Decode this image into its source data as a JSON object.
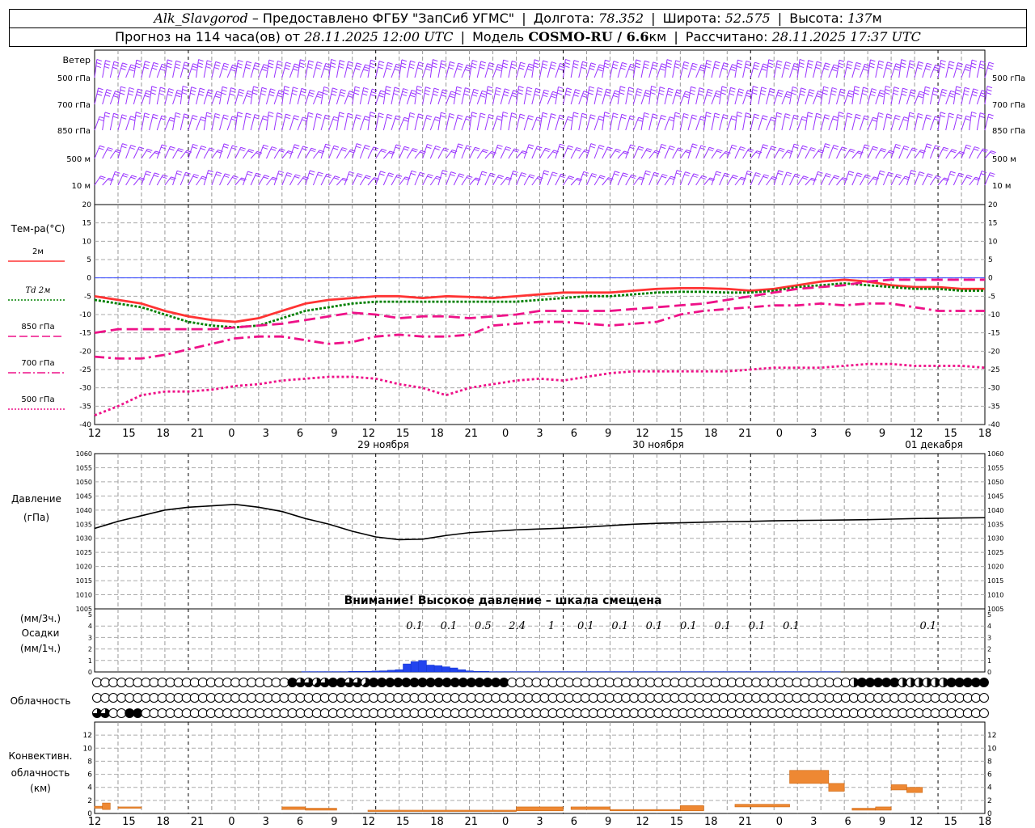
{
  "header": {
    "station": "Alk_Slavgorod",
    "provider": "– Предоставлено ФГБУ \"ЗапСиб УГМС\"",
    "lon_label": "Долгота:",
    "lon": "78.352",
    "lat_label": "Широта:",
    "lat": "52.575",
    "alt_label": "Высота:",
    "alt": "137",
    "alt_unit": "м",
    "forecast_label": "Прогноз на 114 часа(ов) от",
    "forecast_start": "28.11.2025 12:00 UTC",
    "model_label": "Модель",
    "model": "COSMO-RU / 6.6",
    "model_unit": "км",
    "computed_label": "Рассчитано:",
    "computed": "28.11.2025 17:37 UTC"
  },
  "x_axis": {
    "hour_labels": [
      "12",
      "15",
      "18",
      "21",
      "0",
      "3",
      "6",
      "9",
      "12",
      "15",
      "18",
      "21",
      "0",
      "3",
      "6",
      "9",
      "12",
      "15",
      "18",
      "21",
      "0",
      "3",
      "6",
      "9",
      "12",
      "15",
      "18"
    ],
    "day_labels": [
      "29 ноября",
      "30 ноября",
      "01 декабря"
    ]
  },
  "wind_panel": {
    "title": "Ветер",
    "levels": [
      "500 гПа",
      "700 гПа",
      "850 гПа",
      "500 м",
      "10 м"
    ],
    "color": "#9933ff"
  },
  "temp_panel": {
    "title": "Тем-ра(°С)",
    "legend": [
      {
        "label": "2м",
        "color": "#ff3333",
        "style": "solid"
      },
      {
        "label": "Td  2м",
        "color": "#008000",
        "style": "dotted"
      },
      {
        "label": "850 гПа",
        "color": "#ee1188",
        "style": "longdash"
      },
      {
        "label": "700 гПа",
        "color": "#ee1188",
        "style": "dashdot"
      },
      {
        "label": "500 гПа",
        "color": "#ee1188",
        "style": "dotted"
      }
    ],
    "y_ticks": [
      "20",
      "15",
      "10",
      "5",
      "0",
      "-5",
      "-10",
      "-15",
      "-20",
      "-25",
      "-30",
      "-35",
      "-40"
    ]
  },
  "pressure_panel": {
    "title": "Давление",
    "unit": "(гПа)",
    "y_ticks": [
      "1060",
      "1055",
      "1050",
      "1045",
      "1040",
      "1035",
      "1030",
      "1025",
      "1020",
      "1015",
      "1010",
      "1005"
    ],
    "warning": "Внимание! Высокое давление – шкала смещена"
  },
  "precip_panel": {
    "title_lines": [
      "(мм/3ч.)",
      "Осадки",
      "(мм/1ч.)"
    ],
    "y_ticks": [
      "5",
      "4",
      "3",
      "2",
      "1",
      "0"
    ],
    "totals": [
      {
        "i": 9,
        "v": "0.1"
      },
      {
        "i": 10,
        "v": "0.1"
      },
      {
        "i": 11,
        "v": "0.5"
      },
      {
        "i": 12,
        "v": "2.4"
      },
      {
        "i": 13,
        "v": "1"
      },
      {
        "i": 14,
        "v": "0.1"
      },
      {
        "i": 15,
        "v": "0.1"
      },
      {
        "i": 16,
        "v": "0.1"
      },
      {
        "i": 17,
        "v": "0.1"
      },
      {
        "i": 18,
        "v": "0.1"
      },
      {
        "i": 19,
        "v": "0.1"
      },
      {
        "i": 20,
        "v": "0.1"
      },
      {
        "i": 24,
        "v": "0.1"
      }
    ]
  },
  "cloud_panel": {
    "title": "Облачность"
  },
  "conv_panel": {
    "title_lines": [
      "Конвективн.",
      "облачность",
      "(км)"
    ],
    "y_ticks": [
      "12",
      "10",
      "8",
      "6",
      "4",
      "2",
      "0"
    ]
  },
  "chart_data": [
    {
      "type": "line",
      "title": "Тем-ра(°С)",
      "ylim": [
        -40,
        20
      ],
      "x_hours": [
        0,
        3,
        6,
        9,
        12,
        15,
        18,
        21,
        24,
        27,
        30,
        33,
        36,
        39,
        42,
        45,
        48,
        51,
        54,
        57,
        60,
        63,
        66,
        69,
        72,
        75,
        78,
        81,
        84,
        87,
        90,
        93,
        96,
        99,
        102,
        105,
        108,
        111,
        114
      ],
      "series": [
        {
          "name": "2м",
          "values": [
            -5,
            -6,
            -7,
            -9,
            -10.5,
            -11.5,
            -12,
            -11,
            -9,
            -7,
            -6,
            -5.5,
            -5,
            -5,
            -5.5,
            -5,
            -5.2,
            -5.5,
            -5,
            -4.5,
            -4,
            -4,
            -4,
            -3.5,
            -3,
            -2.8,
            -2.8,
            -3,
            -3.5,
            -3,
            -2,
            -1,
            -0.5,
            -1,
            -2,
            -2.5,
            -2.5,
            -3,
            -3
          ]
        },
        {
          "name": "Td  2м",
          "values": [
            -6,
            -7,
            -8,
            -10,
            -12,
            -13,
            -13.5,
            -13,
            -11,
            -9,
            -8,
            -7,
            -6.5,
            -6.5,
            -6.5,
            -6.5,
            -6.5,
            -6.5,
            -6.5,
            -6,
            -5.5,
            -5,
            -5,
            -4.5,
            -4,
            -3.8,
            -3.8,
            -4,
            -4,
            -3.5,
            -2.5,
            -2,
            -1.5,
            -2,
            -2.5,
            -3,
            -3,
            -3.5,
            -3.5
          ]
        },
        {
          "name": "850 гПа",
          "values": [
            -15,
            -14,
            -14,
            -14,
            -14,
            -14,
            -13.5,
            -13,
            -12.5,
            -11.5,
            -10.5,
            -9.5,
            -10,
            -11,
            -10.5,
            -10.5,
            -11,
            -10.5,
            -10,
            -9,
            -9,
            -9,
            -9,
            -8.5,
            -8,
            -7.5,
            -7,
            -6,
            -5,
            -4,
            -3,
            -2.5,
            -2,
            -1,
            -0.5,
            -0.5,
            -0.5,
            -0.5,
            -0.5
          ]
        },
        {
          "name": "700 гПа",
          "values": [
            -21.5,
            -22,
            -22,
            -21,
            -19.5,
            -18,
            -16.5,
            -16,
            -16,
            -17,
            -18,
            -17.5,
            -16,
            -15.5,
            -16,
            -16,
            -15.5,
            -13,
            -12.5,
            -12,
            -12,
            -12.5,
            -13,
            -12.5,
            -12,
            -10,
            -9,
            -8.5,
            -8,
            -7.5,
            -7.5,
            -7,
            -7.5,
            -7,
            -7,
            -8,
            -9,
            -9,
            -9
          ]
        },
        {
          "name": "500 гПа",
          "values": [
            -37.5,
            -35,
            -32,
            -31,
            -31,
            -30.5,
            -29.5,
            -29,
            -28,
            -27.5,
            -27,
            -27,
            -27.5,
            -29,
            -30,
            -32,
            -30,
            -29,
            -28,
            -27.5,
            -28,
            -27,
            -26,
            -25.5,
            -25.5,
            -25.5,
            -25.5,
            -25.5,
            -25,
            -24.5,
            -24.5,
            -24.5,
            -24,
            -23.5,
            -23.5,
            -24,
            -24,
            -24,
            -24.5
          ]
        }
      ]
    },
    {
      "type": "line",
      "title": "Давление",
      "ylabel": "(гПа)",
      "ylim": [
        1005,
        1060
      ],
      "x_hours": [
        0,
        3,
        6,
        9,
        12,
        15,
        18,
        21,
        24,
        27,
        30,
        33,
        36,
        39,
        42,
        45,
        48,
        51,
        54,
        57,
        60,
        63,
        66,
        69,
        72,
        75,
        78,
        81,
        84,
        87,
        90,
        93,
        96,
        99,
        102,
        105,
        108,
        111,
        114
      ],
      "series": [
        {
          "name": "",
          "values": [
            1033.5,
            1036,
            1038,
            1040,
            1041,
            1041.5,
            1042,
            1041,
            1039.5,
            1037,
            1035,
            1032.5,
            1030.5,
            1029.5,
            1029.7,
            1031,
            1032,
            1032.5,
            1033,
            1033.3,
            1033.6,
            1034,
            1034.5,
            1035,
            1035.3,
            1035.5,
            1035.7,
            1035.9,
            1036,
            1036.2,
            1036.3,
            1036.4,
            1036.5,
            1036.6,
            1036.8,
            1037,
            1037.1,
            1037.2,
            1037.3
          ]
        }
      ]
    },
    {
      "type": "bar",
      "title": "Осадки",
      "ylabel": "(мм/1ч.)",
      "ylim": [
        0,
        5
      ],
      "x_hours": [
        27,
        28,
        29,
        30,
        31,
        32,
        33,
        34,
        35,
        36,
        37,
        38,
        39,
        40,
        41,
        42,
        43,
        44,
        45,
        46,
        47,
        48,
        49,
        50,
        51,
        52,
        53,
        54,
        55,
        56,
        57,
        58,
        59,
        60,
        61,
        62,
        63,
        64,
        65,
        66,
        67,
        68,
        69,
        70,
        71,
        72,
        73,
        74,
        75,
        76,
        77,
        78,
        79,
        80,
        81,
        82,
        83,
        84,
        85,
        86,
        87,
        88,
        89,
        90,
        91,
        92,
        93,
        94,
        95
      ],
      "values": [
        0.03,
        0.03,
        0.03,
        0.03,
        0.03,
        0.03,
        0.05,
        0.05,
        0.05,
        0.08,
        0.1,
        0.15,
        0.2,
        0.7,
        0.9,
        1.0,
        0.6,
        0.55,
        0.45,
        0.35,
        0.2,
        0.1,
        0.05,
        0.05,
        0.03,
        0.03,
        0.03,
        0.03,
        0.03,
        0.03,
        0.03,
        0.03,
        0.03,
        0.03,
        0.03,
        0.03,
        0.03,
        0.03,
        0.03,
        0.03,
        0.03,
        0.03,
        0.03,
        0.03,
        0.03,
        0.03,
        0.03,
        0.03,
        0.03,
        0.03,
        0.03,
        0.03,
        0.03,
        0.03,
        0.03,
        0.03,
        0.03,
        0.03,
        0.03,
        0.03,
        0.03,
        0.03,
        0.03,
        0.03,
        0.03,
        0.03,
        0.03,
        0.03,
        0.03
      ]
    },
    {
      "type": "bar",
      "title": "Облачность",
      "note": "cloud cover in eighths (0-8), three rows, per hour",
      "rows": [
        "0000000000000000000000008665688665888888888888888880000000000000000000000000000000000000000004888884444448888888444444444444444444448888888888888888",
        "0000000000000000000000000000000000000000000000000000000000000000000000000000000000000000000000000000000000000000000000000000000000000000000000000000",
        "6600880000000000000000000000000000000000000000000000000000000000000000000000000000000000000000000000000000000000000000000000000000000000000000000000"
      ]
    },
    {
      "type": "bar",
      "title": "Конвективн. облачность",
      "ylabel": "(км)",
      "ylim": [
        0,
        14
      ],
      "segments": [
        {
          "from": 0,
          "to": 1,
          "bottom": 0.8,
          "top": 1.1
        },
        {
          "from": 1,
          "to": 2,
          "bottom": 0.6,
          "top": 1.6
        },
        {
          "from": 3,
          "to": 6,
          "bottom": 0.8,
          "top": 1.0
        },
        {
          "from": 24,
          "to": 27,
          "bottom": 0.6,
          "top": 1.0
        },
        {
          "from": 27,
          "to": 31,
          "bottom": 0.5,
          "top": 0.8
        },
        {
          "from": 35,
          "to": 54,
          "bottom": 0.3,
          "top": 0.5
        },
        {
          "from": 54,
          "to": 60,
          "bottom": 0.4,
          "top": 1.0
        },
        {
          "from": 61,
          "to": 66,
          "bottom": 0.6,
          "top": 1.0
        },
        {
          "from": 66,
          "to": 75,
          "bottom": 0.4,
          "top": 0.6
        },
        {
          "from": 75,
          "to": 78,
          "bottom": 0.4,
          "top": 1.2
        },
        {
          "from": 82,
          "to": 89,
          "bottom": 1.0,
          "top": 1.4
        },
        {
          "from": 89,
          "to": 94,
          "bottom": 4.6,
          "top": 6.6
        },
        {
          "from": 94,
          "to": 96,
          "bottom": 3.4,
          "top": 4.6
        },
        {
          "from": 97,
          "to": 100,
          "bottom": 0.5,
          "top": 0.8
        },
        {
          "from": 100,
          "to": 102,
          "bottom": 0.5,
          "top": 1.0
        },
        {
          "from": 102,
          "to": 104,
          "bottom": 3.6,
          "top": 4.4
        },
        {
          "from": 104,
          "to": 106,
          "bottom": 3.2,
          "top": 4.0
        }
      ]
    }
  ]
}
